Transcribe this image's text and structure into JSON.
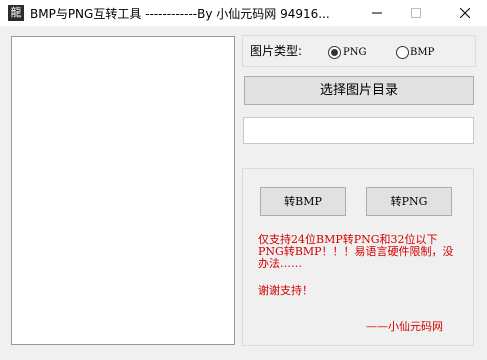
{
  "window": {
    "title": "BMP与PNG互转工具   ------------By 小仙元码网 94916...",
    "icon_glyph": "龍"
  },
  "image_type": {
    "label": "图片类型:",
    "options": [
      {
        "label": "PNG",
        "selected": true
      },
      {
        "label": "BMP",
        "selected": false
      }
    ]
  },
  "buttons": {
    "select_dir": "选择图片目录",
    "to_bmp": "转BMP",
    "to_png": "转PNG"
  },
  "path_input": {
    "value": "",
    "placeholder": ""
  },
  "note": {
    "text": "仅支持24位BMP转PNG和32位以下PNG转BMP！！！易语言硬件限制，没办法……",
    "thanks": "谢谢支持！",
    "signature": "——小仙元码网",
    "color": "#d40000"
  }
}
